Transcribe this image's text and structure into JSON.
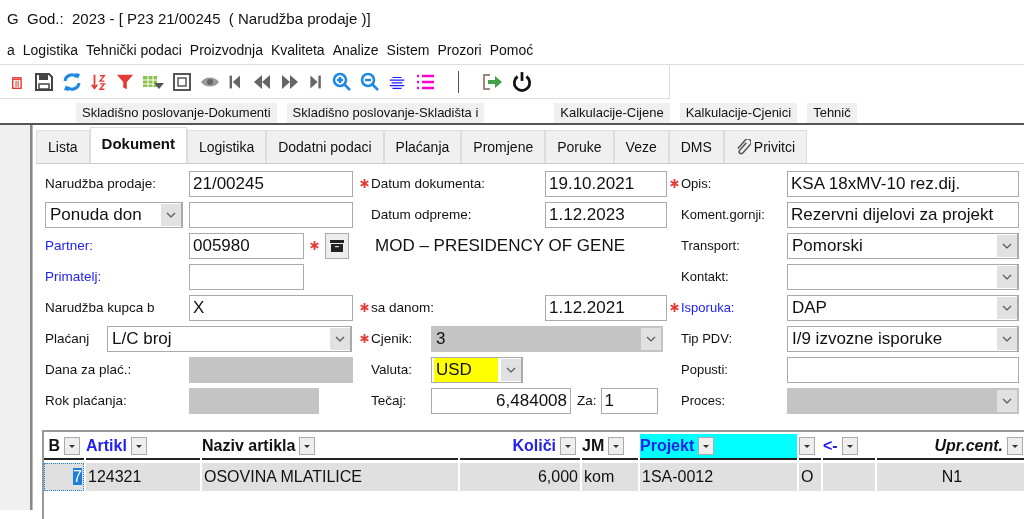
{
  "window": {
    "title": "G  God.:  2023 - [ P23 21/00245  ( Narudžba prodaje )]"
  },
  "menu": [
    "a",
    "Logistika",
    "Tehnički podaci",
    "Proizvodnja",
    "Kvaliteta",
    "Analize",
    "Sistem",
    "Prozori",
    "Pomoć"
  ],
  "module_tabs": [
    "Skladišno poslovanje-Dokumenti",
    "Skladišno poslovanje-Skladišta i",
    "Kalkulacije-Cijene",
    "Kalkulacije-Cjenici",
    "Tehnič"
  ],
  "tabs": [
    {
      "label": "Lista",
      "selected": false,
      "kind": "plain"
    },
    {
      "label": "Dokument",
      "selected": true,
      "kind": "plain"
    },
    {
      "label": "Logistika",
      "selected": false,
      "kind": "plain"
    },
    {
      "label": "Dodatni podaci",
      "selected": false,
      "kind": "plain"
    },
    {
      "label": "Plaćanja",
      "selected": false,
      "kind": "plain"
    },
    {
      "label": "Promjene",
      "selected": false,
      "kind": "plain"
    },
    {
      "label": "Poruke",
      "selected": false,
      "kind": "plain"
    },
    {
      "label": "Veze",
      "selected": false,
      "kind": "plain"
    },
    {
      "label": "DMS",
      "selected": false,
      "kind": "plain"
    },
    {
      "label": "Privitci",
      "selected": false,
      "kind": "attachment"
    }
  ],
  "form": {
    "rows": [
      {
        "left": {
          "label": "Narudžba prodaje:",
          "controls": [
            {
              "kind": "text",
              "value": "21/00245"
            }
          ]
        },
        "middle": {
          "label": "Datum dokumenta:",
          "required": true,
          "controls": [
            {
              "kind": "text",
              "value": "19.10.2021"
            }
          ]
        },
        "right": {
          "label": "Opis:",
          "required": true,
          "controls": [
            {
              "kind": "text",
              "value": "KSA 18xMV-10 rez.dij."
            }
          ]
        }
      },
      {
        "left": {
          "controls": [
            {
              "kind": "combo",
              "value": "Ponuda don"
            },
            {
              "kind": "text"
            }
          ]
        },
        "middle": {
          "label": "Datum odpreme:",
          "controls": [
            {
              "kind": "text",
              "value": "1.12.2023"
            }
          ]
        },
        "right": {
          "label": "Koment.gornji:",
          "controls": [
            {
              "kind": "text",
              "value": "Rezervni dijelovi za projekt"
            }
          ]
        }
      },
      {
        "left": {
          "label": "Partner:",
          "link": true,
          "controls": [
            {
              "kind": "text",
              "value": "005980"
            },
            {
              "kind": "lookup",
              "required": true
            }
          ]
        },
        "middle": {
          "text": "MOD – PRESIDENCY OF GENE"
        },
        "right": {
          "label": "Transport:",
          "controls": [
            {
              "kind": "combo",
              "value": "Pomorski"
            }
          ]
        }
      },
      {
        "left": {
          "label": "Primatelj:",
          "link": true,
          "controls": [
            {
              "kind": "text"
            }
          ]
        },
        "right": {
          "label": "Kontakt:",
          "controls": [
            {
              "kind": "combo"
            }
          ]
        }
      },
      {
        "left": {
          "label": "Narudžba kupca b",
          "controls": [
            {
              "kind": "text",
              "value": "X"
            }
          ]
        },
        "middle": {
          "label": "sa danom:",
          "required": true,
          "controls": [
            {
              "kind": "text",
              "value": "1.12.2021"
            }
          ]
        },
        "right": {
          "label": "Isporuka:",
          "required": true,
          "link": true,
          "controls": [
            {
              "kind": "combo",
              "value": "DAP"
            }
          ]
        }
      },
      {
        "left": {
          "label": "Plaćanj",
          "controls": [
            {
              "kind": "combo",
              "value": "L/C broj"
            }
          ]
        },
        "middle": {
          "label": "Cjenik:",
          "required": true,
          "controls": [
            {
              "kind": "combo",
              "value": "3",
              "disabled": true
            }
          ]
        },
        "right": {
          "label": "Tip PDV:",
          "controls": [
            {
              "kind": "combo",
              "value": "I/9 izvozne isporuke"
            }
          ]
        }
      },
      {
        "left": {
          "label": "Dana za plać.:",
          "controls": [
            {
              "kind": "text",
              "disabled": true
            }
          ]
        },
        "middle": {
          "label": "Valuta:",
          "controls": [
            {
              "kind": "combo",
              "value": "USD",
              "highlighted": true
            }
          ]
        },
        "right": {
          "label": "Popusti:",
          "controls": [
            {
              "kind": "text"
            }
          ]
        }
      },
      {
        "left": {
          "label": "Rok plaćanja:",
          "controls": [
            {
              "kind": "text",
              "disabled": true
            }
          ]
        },
        "middle": {
          "label": "Tečaj:",
          "controls": [
            {
              "kind": "number",
              "value": "6,484008"
            },
            {
              "kind": "label",
              "text": "Za:"
            },
            {
              "kind": "text",
              "value": "1"
            }
          ]
        },
        "right": {
          "label": "Proces:",
          "controls": [
            {
              "kind": "combo",
              "disabled": true
            }
          ]
        }
      }
    ]
  },
  "grid": {
    "columns": [
      {
        "label": "B",
        "kind": "plain"
      },
      {
        "label": "Artikl",
        "kind": "key"
      },
      {
        "label": "Naziv artikla",
        "kind": "plain"
      },
      {
        "label": "Količi",
        "kind": "key"
      },
      {
        "label": "JM",
        "kind": "plain"
      },
      {
        "label": "Projekt",
        "kind": "highlighted"
      },
      {
        "kind": "plain"
      },
      {
        "label": "<-",
        "kind": "key"
      },
      {
        "label": "Upr.cent.",
        "kind": "italic"
      }
    ],
    "rows": [
      {
        "selected": true,
        "cells": [
          {
            "text": "7",
            "selected": true
          },
          {
            "text": "124321",
            "selected": false
          },
          {
            "text": "OSOVINA MLATILICE",
            "selected": false
          },
          {
            "text": "6,000",
            "selected": false
          },
          {
            "text": "kom",
            "selected": false
          },
          {
            "text": "1SA-0012",
            "selected": false
          },
          {
            "text": "O",
            "selected": false
          },
          {
            "selected": false
          },
          {
            "text": "N1",
            "selected": false
          }
        ]
      }
    ]
  }
}
